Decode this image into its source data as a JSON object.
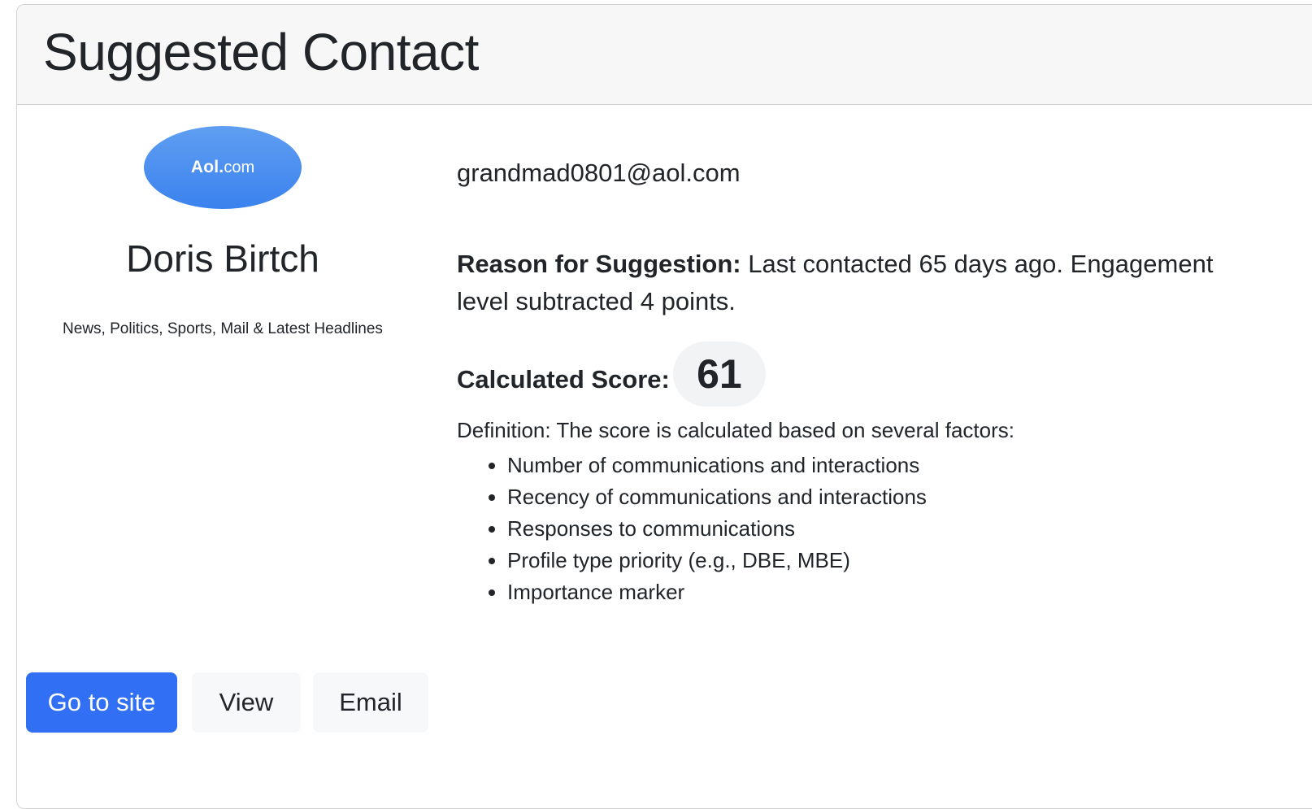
{
  "card": {
    "title": "Suggested Contact"
  },
  "contact": {
    "logo": {
      "brand": "Aol.",
      "tld": "com",
      "color": "#4a8df0"
    },
    "name": "Doris Birtch",
    "description": "News, Politics, Sports, Mail & Latest Headlines",
    "email": "grandmad0801@aol.com"
  },
  "reason": {
    "label": "Reason for Suggestion:",
    "text": " Last contacted 65 days ago. Engagement level subtracted 4 points."
  },
  "score": {
    "label": "Calculated Score:",
    "value": "61"
  },
  "definition": {
    "text": "Definition: The score is calculated based on several factors:",
    "factors": [
      "Number of communications and interactions",
      "Recency of communications and interactions",
      "Responses to communications",
      "Profile type priority (e.g., DBE, MBE)",
      "Importance marker"
    ]
  },
  "actions": {
    "go_to_site": "Go to site",
    "view": "View",
    "email": "Email"
  },
  "colors": {
    "primary": "#316ff5",
    "header_bg": "#f7f7f7",
    "text": "#212529"
  }
}
